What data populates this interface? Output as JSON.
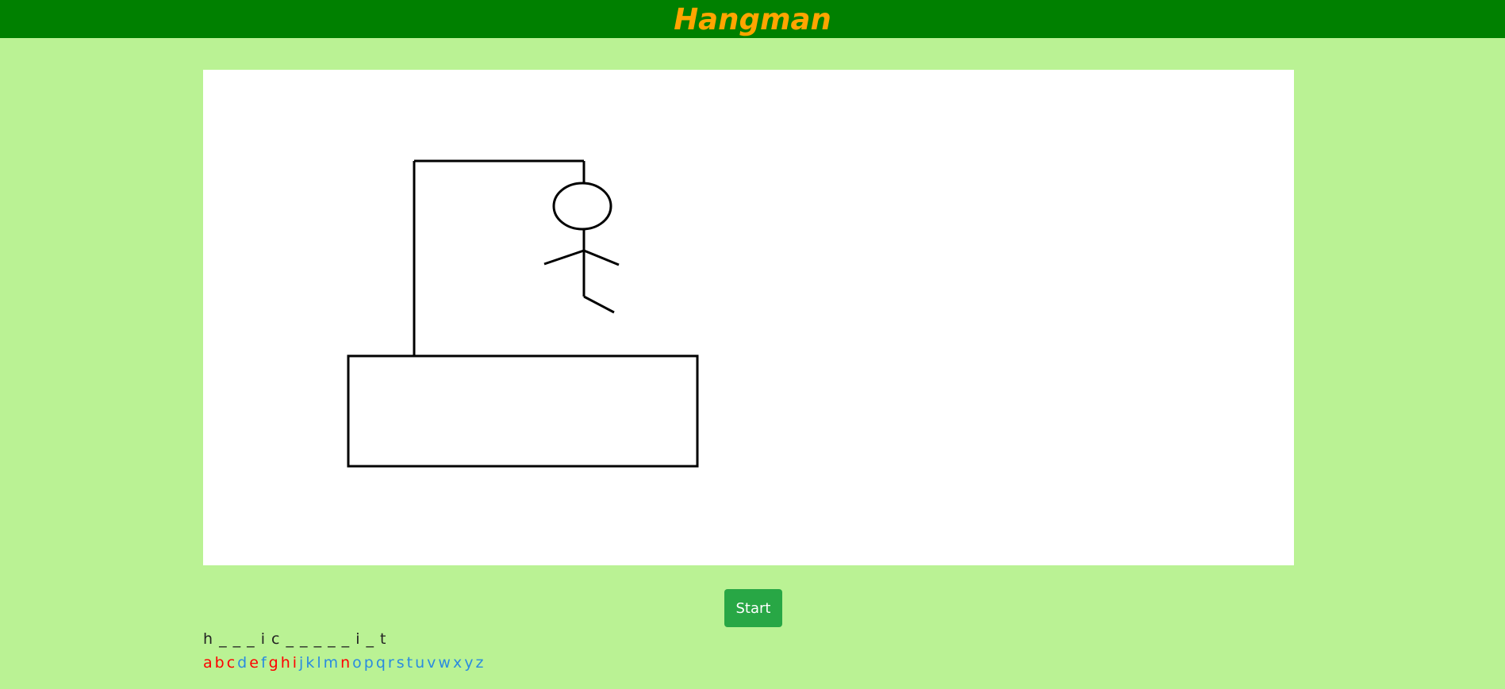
{
  "header": {
    "title": "Hangman",
    "background": "#008000",
    "title_color": "#ffa500"
  },
  "start_button": {
    "label": "Start",
    "color": "#28a745"
  },
  "word_display": "h _ _ _ i c _ _ _ _ _ i _ t",
  "alphabet": [
    {
      "letter": "a",
      "state": "wrong"
    },
    {
      "letter": "b",
      "state": "wrong"
    },
    {
      "letter": "c",
      "state": "wrong"
    },
    {
      "letter": "d",
      "state": "available"
    },
    {
      "letter": "e",
      "state": "wrong"
    },
    {
      "letter": "f",
      "state": "available"
    },
    {
      "letter": "g",
      "state": "wrong"
    },
    {
      "letter": "h",
      "state": "wrong"
    },
    {
      "letter": "i",
      "state": "wrong"
    },
    {
      "letter": "j",
      "state": "available"
    },
    {
      "letter": "k",
      "state": "available"
    },
    {
      "letter": "l",
      "state": "available"
    },
    {
      "letter": "m",
      "state": "available"
    },
    {
      "letter": "n",
      "state": "wrong"
    },
    {
      "letter": "o",
      "state": "available"
    },
    {
      "letter": "p",
      "state": "available"
    },
    {
      "letter": "q",
      "state": "available"
    },
    {
      "letter": "r",
      "state": "available"
    },
    {
      "letter": "s",
      "state": "available"
    },
    {
      "letter": "t",
      "state": "available"
    },
    {
      "letter": "u",
      "state": "available"
    },
    {
      "letter": "v",
      "state": "available"
    },
    {
      "letter": "w",
      "state": "available"
    },
    {
      "letter": "x",
      "state": "available"
    },
    {
      "letter": "y",
      "state": "available"
    },
    {
      "letter": "z",
      "state": "available"
    }
  ],
  "letter_colors": {
    "wrong": "#ff0000",
    "available": "#2a8be0"
  },
  "page_background": "#baf294"
}
